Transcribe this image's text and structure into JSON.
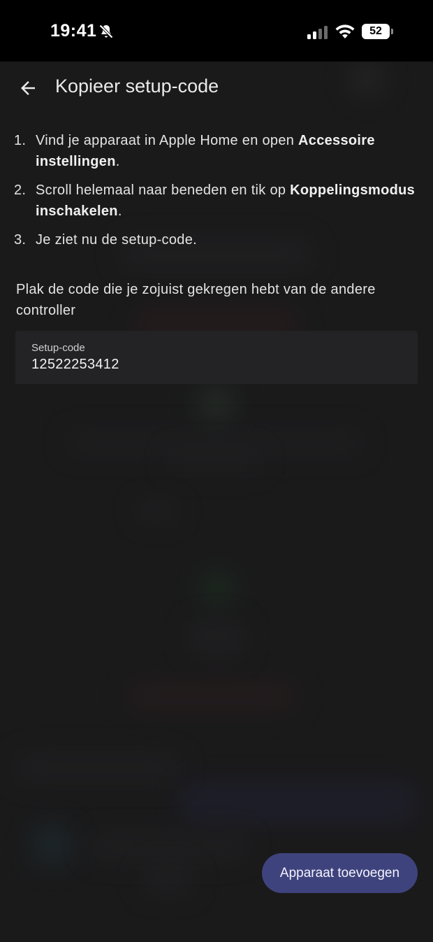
{
  "status_bar": {
    "time": "19:41",
    "battery_level": "52"
  },
  "header": {
    "title": "Kopieer setup-code"
  },
  "steps": [
    {
      "number": "1.",
      "text_before": "Vind je apparaat in Apple Home en open ",
      "bold": "Accessoire instellingen",
      "text_after": "."
    },
    {
      "number": "2.",
      "text_before": "Scroll helemaal naar beneden en tik op ",
      "bold": "Koppelingsmodus inschakelen",
      "text_after": "."
    },
    {
      "number": "3.",
      "text_before": "Je ziet nu de setup-code.",
      "bold": "",
      "text_after": ""
    }
  ],
  "instruction": "Plak de code die je zojuist gekregen hebt van de andere controller",
  "setup_code_field": {
    "label": "Setup-code",
    "value": "12522253412"
  },
  "primary_button": {
    "label": "Apparaat toevoegen"
  },
  "icons": {
    "back": "arrow-left-icon",
    "mute": "bell-slash-icon",
    "signal": "cellular-signal-icon",
    "wifi": "wifi-icon",
    "battery": "battery-icon"
  },
  "colors": {
    "background": "#1a1a1b",
    "field_background": "#232325",
    "button_background": "#3f437d",
    "text": "#e4e4e4"
  }
}
